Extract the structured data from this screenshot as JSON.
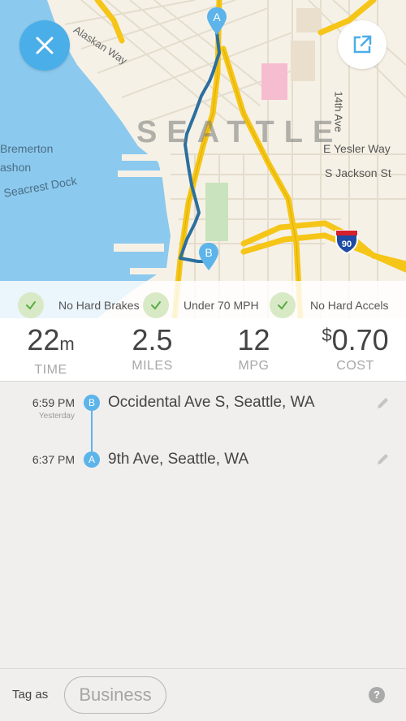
{
  "map": {
    "labels": {
      "city": "SEATTLE",
      "alaskan_way": "Alaskan Way",
      "yesler": "E Yesler Way",
      "jackson": "S Jackson St",
      "fourteenth": "14th Ave",
      "bremerton": "Bremerton",
      "ashon": "ashon",
      "seacrest": "Seacrest Dock",
      "interstate": "90"
    },
    "pin_a": "A",
    "pin_b": "B",
    "colors": {
      "water": "#8cc9ee",
      "land": "#f6f1e6",
      "highway": "#f5c518",
      "route": "#2b6f9f"
    }
  },
  "badges": [
    {
      "label": "No Hard Brakes",
      "icon": "check-icon"
    },
    {
      "label": "Under 70 MPH",
      "icon": "check-icon"
    },
    {
      "label": "No Hard Accels",
      "icon": "check-icon"
    }
  ],
  "stats": {
    "time": {
      "value": "22",
      "unit": "m",
      "label": "TIME"
    },
    "miles": {
      "value": "2.5",
      "label": "MILES"
    },
    "mpg": {
      "value": "12",
      "label": "MPG"
    },
    "cost": {
      "currency": "$",
      "value": "0.70",
      "label": "COST"
    }
  },
  "trip": {
    "end": {
      "time": "6:59 PM",
      "day": "Yesterday",
      "marker": "B",
      "address": "Occidental Ave S, Seattle, WA"
    },
    "start": {
      "time": "6:37 PM",
      "marker": "A",
      "address": "9th Ave, Seattle, WA"
    }
  },
  "footer": {
    "tag_label": "Tag as",
    "tag_value": "Business",
    "help": "?"
  }
}
